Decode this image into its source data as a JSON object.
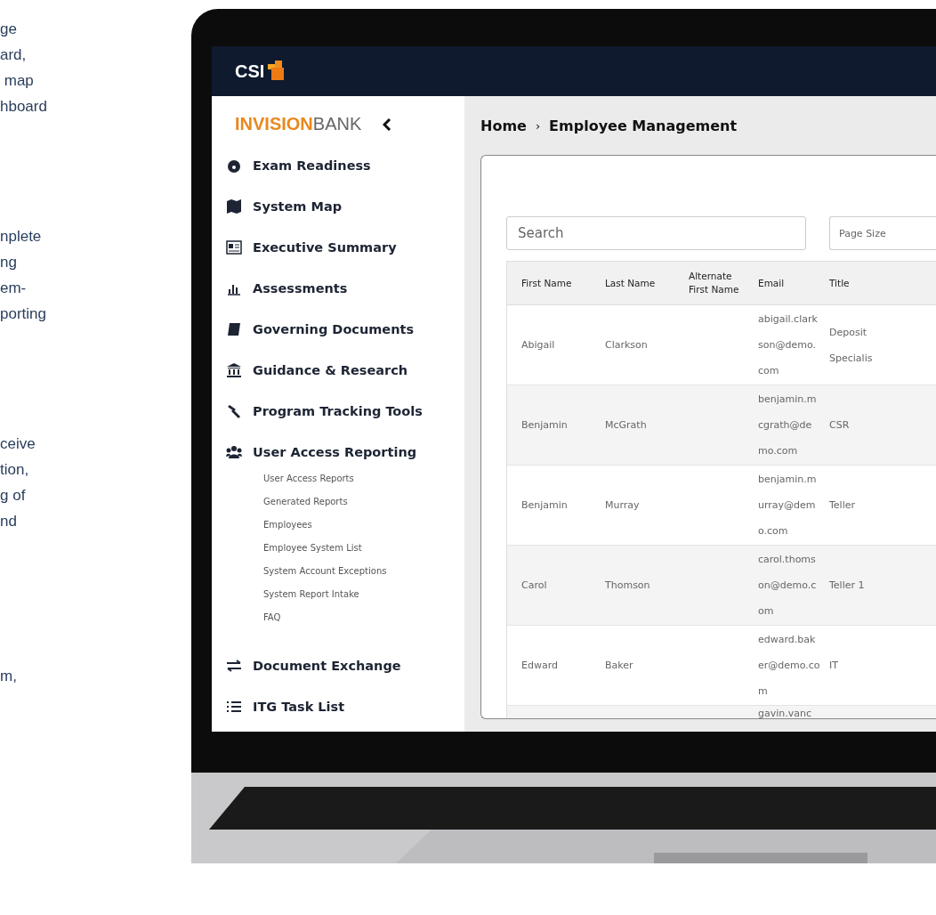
{
  "side_text": [
    [
      "ge",
      "ard,",
      " map",
      "hboard"
    ],
    [
      "nplete",
      "ng",
      "em-",
      "porting"
    ],
    [
      "ceive",
      "tion,",
      "g of",
      "nd"
    ],
    [
      "m,"
    ]
  ],
  "app": {
    "logo": "CSI",
    "sidebar": {
      "brand_bold": "INVISION",
      "brand_light": "BANK",
      "items": [
        {
          "label": "Exam Readiness"
        },
        {
          "label": "System Map"
        },
        {
          "label": "Executive Summary"
        },
        {
          "label": "Assessments"
        },
        {
          "label": "Governing Documents"
        },
        {
          "label": "Guidance & Research"
        },
        {
          "label": "Program Tracking Tools"
        },
        {
          "label": "User Access Reporting",
          "children": [
            {
              "label": "User Access Reports"
            },
            {
              "label": "Generated Reports"
            },
            {
              "label": "Employees"
            },
            {
              "label": "Employee System List"
            },
            {
              "label": "System Account Exceptions"
            },
            {
              "label": "System Report Intake"
            },
            {
              "label": "FAQ"
            }
          ]
        },
        {
          "label": "Document Exchange"
        },
        {
          "label": "ITG Task List"
        }
      ]
    },
    "breadcrumb": {
      "home": "Home",
      "separator": "›",
      "current": "Employee Management"
    },
    "search": {
      "placeholder": "Search"
    },
    "page_size": {
      "placeholder": "Page Size"
    },
    "table": {
      "columns": [
        "First Name",
        "Last Name",
        "Alternate First Name",
        "Email",
        "Title"
      ],
      "rows": [
        [
          "Abigail",
          "Clarkson",
          "",
          "abigail.clarkson@demo.com",
          "Deposit Specialis"
        ],
        [
          "Benjamin",
          "McGrath",
          "",
          "benjamin.mcgrath@demo.com",
          "CSR"
        ],
        [
          "Benjamin",
          "Murray",
          "",
          "benjamin.murray@demo.com",
          "Teller"
        ],
        [
          "Carol",
          "Thomson",
          "",
          "carol.thomson@demo.com",
          "Teller 1"
        ],
        [
          "Edward",
          "Baker",
          "",
          "edward.baker@demo.com",
          "IT"
        ],
        [
          "",
          "",
          "",
          "gavin.vanc",
          ""
        ]
      ]
    }
  }
}
